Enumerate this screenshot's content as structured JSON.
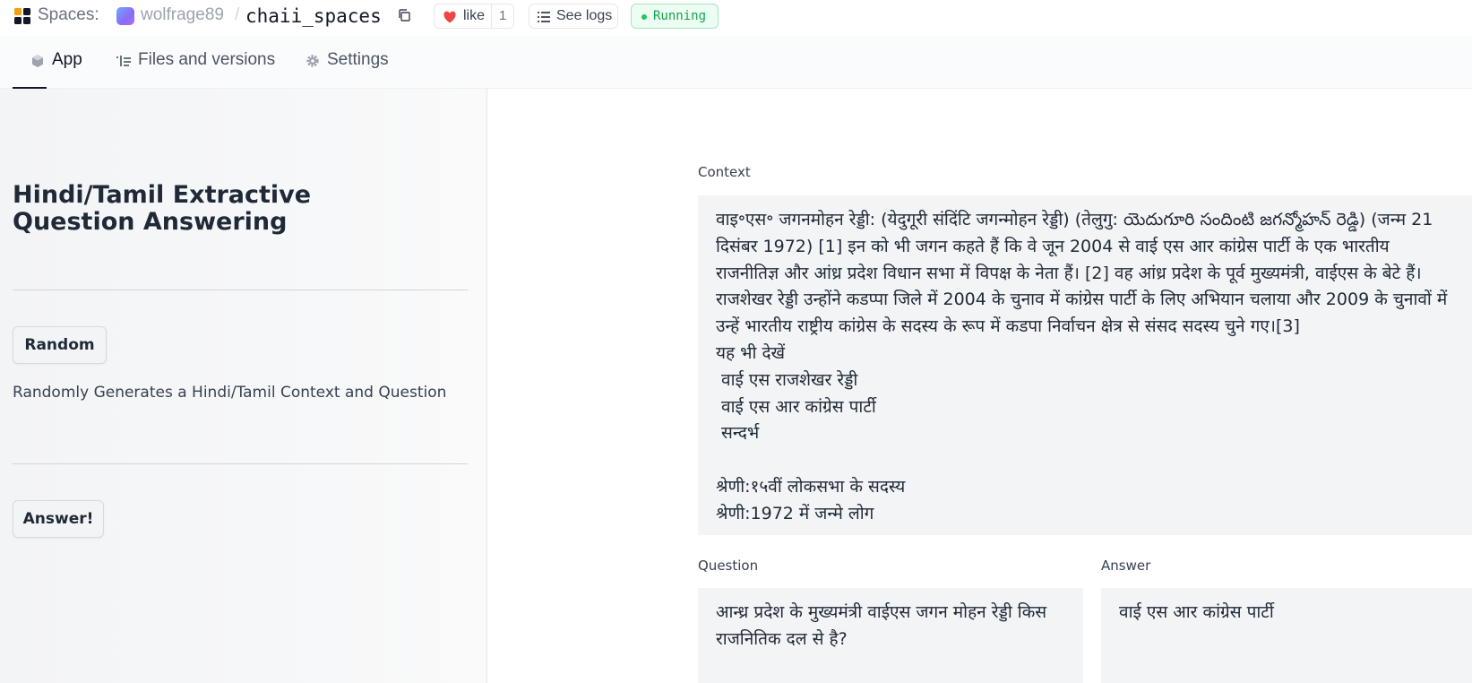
{
  "header": {
    "spaces_label": "Spaces:",
    "owner": "wolfrage89",
    "separator": "/",
    "repo": "chaii_spaces",
    "like_label": "like",
    "like_count": "1",
    "logs_label": "See logs",
    "status": "Running",
    "status_color": "#16a34a"
  },
  "tabs": [
    {
      "label": "App",
      "icon": "app-icon",
      "active": true
    },
    {
      "label": "Files and versions",
      "icon": "files-icon",
      "active": false
    },
    {
      "label": "Settings",
      "icon": "gear-icon",
      "active": false
    }
  ],
  "sidebar": {
    "title": "Hindi/Tamil Extractive Question Answering",
    "random_button": "Random",
    "random_help": "Randomly Generates a Hindi/Tamil Context and Question",
    "answer_button": "Answer!"
  },
  "main": {
    "context_label": "Context",
    "context_value": "वाइ॰एस॰ जगनमोहन रेड्डी: (येदुगूरी संदिंटि जगन्मोहन रेड्डी) (तेलुगु: యెదుగూరి సందింటి జగన్మోహన్ రెడ్డి) (जन्म 21 दिसंबर 1972) [1] इन को भी जगन कहते हैं कि वे जून 2004 से वाई एस आर कांग्रेस पार्टी के एक भारतीय राजनीतिज्ञ और आंध्र प्रदेश विधान सभा में विपक्ष के नेता हैं। [2] वह आंध्र प्रदेश के पूर्व मुख्यमंत्री, वाईएस के बेटे हैं। राजशेखर रेड्डी उन्होंने कडप्पा जिले में 2004 के चुनाव में कांग्रेस पार्टी के लिए अभियान चलाया और 2009 के चुनावों में उन्हें भारतीय राष्ट्रीय कांग्रेस के सदस्य के रूप में कडपा निर्वाचन क्षेत्र से संसद सदस्य चुने गए।[3]\nयह भी देखें\n वाई एस राजशेखर रेड्डी\n वाई एस आर कांग्रेस पार्टी\n सन्दर्भ\n\nश्रेणी:१५वीं लोकसभा के सदस्य\nश्रेणी:1972 में जन्मे लोग",
    "question_label": "Question",
    "question_value": "आन्ध्र प्रदेश के मुख्यमंत्री वाईएस जगन मोहन रेड्डी किस राजनितिक दल से है?",
    "answer_label": "Answer",
    "answer_value": "वाई एस आर कांग्रेस पार्टी"
  }
}
